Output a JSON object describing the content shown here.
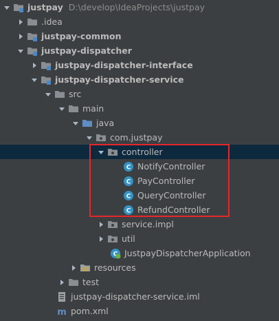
{
  "colors": {
    "background": "#3c3f41",
    "selection": "#0d293e",
    "text": "#bbbbbb",
    "path_text": "#8c8c8c",
    "folder": "#8a8e92",
    "module_folder": "#7f8b99",
    "source_folder": "#5e8dc3",
    "resources_folder": "#9aa0a6",
    "package": "#8a8e92",
    "class_icon": "#3592c4",
    "highlight_border": "#e8262b"
  },
  "tree": {
    "root": {
      "label": "justpay",
      "path": "D:\\develop\\IdeaProjects\\justpay"
    },
    "idea": {
      "label": ".idea"
    },
    "common": {
      "label": "justpay-common"
    },
    "dispatcher": {
      "label": "justpay-dispatcher"
    },
    "dispatcher_interface": {
      "label": "justpay-dispatcher-interface"
    },
    "dispatcher_service": {
      "label": "justpay-dispatcher-service"
    },
    "src": {
      "label": "src"
    },
    "main": {
      "label": "main"
    },
    "java": {
      "label": "java"
    },
    "com_justpay": {
      "label": "com.justpay"
    },
    "controller": {
      "label": "controller"
    },
    "classes": [
      {
        "label": "NotifyController",
        "icon": "class-icon"
      },
      {
        "label": "PayController",
        "icon": "class-icon"
      },
      {
        "label": "QueryController",
        "icon": "class-icon"
      },
      {
        "label": "RefundController",
        "icon": "class-icon"
      }
    ],
    "service_impl": {
      "label": "service.impl"
    },
    "util": {
      "label": "util"
    },
    "application": {
      "label": "JustpayDispatcherApplication",
      "icon": "spring-boot-class-icon"
    },
    "resources": {
      "label": "resources"
    },
    "test": {
      "label": "test"
    },
    "iml": {
      "label": "justpay-dispatcher-service.iml"
    },
    "pom": {
      "label": "pom.xml",
      "icon": "maven-icon"
    }
  }
}
